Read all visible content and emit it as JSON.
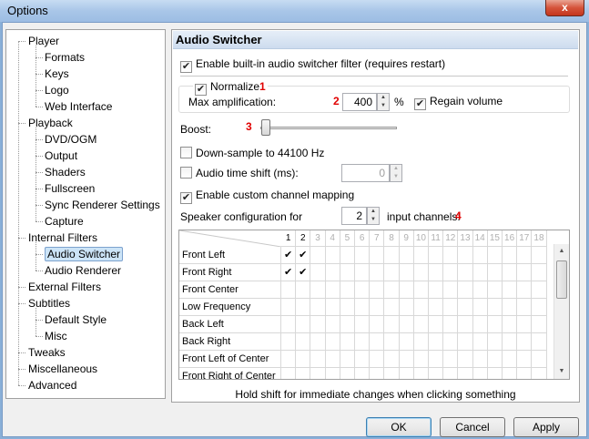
{
  "window": {
    "title": "Options",
    "close_glyph": "x"
  },
  "tree": {
    "items": [
      {
        "label": "Player",
        "level": 0
      },
      {
        "label": "Formats",
        "level": 1
      },
      {
        "label": "Keys",
        "level": 1
      },
      {
        "label": "Logo",
        "level": 1
      },
      {
        "label": "Web Interface",
        "level": 1
      },
      {
        "label": "Playback",
        "level": 0
      },
      {
        "label": "DVD/OGM",
        "level": 1
      },
      {
        "label": "Output",
        "level": 1
      },
      {
        "label": "Shaders",
        "level": 1
      },
      {
        "label": "Fullscreen",
        "level": 1
      },
      {
        "label": "Sync Renderer Settings",
        "level": 1
      },
      {
        "label": "Capture",
        "level": 1
      },
      {
        "label": "Internal Filters",
        "level": 0
      },
      {
        "label": "Audio Switcher",
        "level": 1,
        "selected": true
      },
      {
        "label": "Audio Renderer",
        "level": 1
      },
      {
        "label": "External Filters",
        "level": 0
      },
      {
        "label": "Subtitles",
        "level": 0
      },
      {
        "label": "Default Style",
        "level": 1
      },
      {
        "label": "Misc",
        "level": 1
      },
      {
        "label": "Tweaks",
        "level": 0
      },
      {
        "label": "Miscellaneous",
        "level": 0
      },
      {
        "label": "Advanced",
        "level": 0
      }
    ]
  },
  "panel": {
    "title": "Audio Switcher",
    "enable_filter": {
      "label": "Enable built-in audio switcher filter (requires restart)",
      "checked": true
    },
    "normalize": {
      "label": "Normalize",
      "checked": true,
      "marker": "1"
    },
    "max_amp": {
      "label": "Max amplification:",
      "value": "400",
      "unit": "%",
      "marker": "2"
    },
    "regain": {
      "label": "Regain volume",
      "checked": true
    },
    "boost": {
      "label": "Boost:",
      "marker": "3"
    },
    "downsample": {
      "label": "Down-sample to 44100 Hz",
      "checked": false
    },
    "timeshift": {
      "label": "Audio time shift (ms):",
      "value": "0",
      "checked": false
    },
    "custom_mapping": {
      "label": "Enable custom channel mapping",
      "checked": true
    },
    "speaker": {
      "label": "Speaker configuration for",
      "value": "2",
      "suffix": "input channels:",
      "marker": "4"
    },
    "channel_headers": [
      "1",
      "2",
      "3",
      "4",
      "5",
      "6",
      "7",
      "8",
      "9",
      "10",
      "11",
      "12",
      "13",
      "14",
      "15",
      "16",
      "17",
      "18"
    ],
    "channel_rows": [
      {
        "label": "Front Left",
        "checks": [
          1,
          1
        ]
      },
      {
        "label": "Front Right",
        "checks": [
          1,
          1
        ]
      },
      {
        "label": "Front Center",
        "checks": [
          0,
          0
        ]
      },
      {
        "label": "Low Frequency",
        "checks": [
          0,
          0
        ]
      },
      {
        "label": "Back Left",
        "checks": [
          0,
          0
        ]
      },
      {
        "label": "Back Right",
        "checks": [
          0,
          0
        ]
      },
      {
        "label": "Front Left of Center",
        "checks": [
          0,
          0
        ]
      },
      {
        "label": "Front Right of Center",
        "checks": [
          0,
          0
        ]
      }
    ],
    "check_glyph": "✔",
    "hint": "Hold shift for immediate changes when clicking something"
  },
  "buttons": {
    "ok": "OK",
    "cancel": "Cancel",
    "apply": "Apply"
  },
  "colors": {
    "marker": "#e00000",
    "selection": "#cce4f7"
  }
}
